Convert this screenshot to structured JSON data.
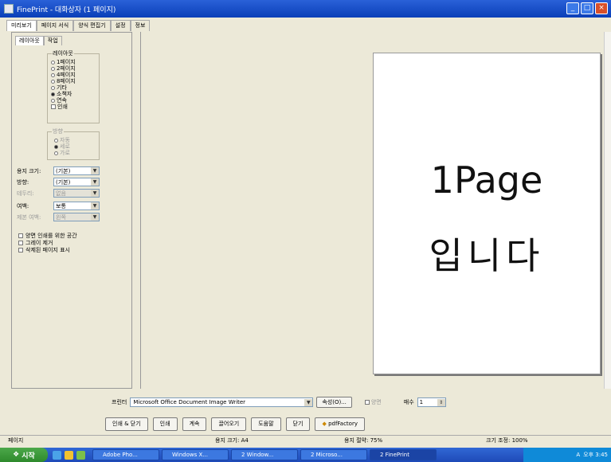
{
  "window": {
    "title": "FinePrint - 대화상자 (1 페이지)"
  },
  "tabs": [
    "미리보기",
    "페이지 서식",
    "양식 편집기",
    "설정",
    "정보"
  ],
  "left_panel": {
    "subtabs": [
      "레이아웃",
      "작업"
    ],
    "layout_group": {
      "label": "레이아웃",
      "options": [
        "1페이지",
        "2페이지",
        "4페이지",
        "8페이지",
        "기타",
        "소책자",
        "연속"
      ],
      "checked": 5,
      "extra_check": "인쇄"
    },
    "orientation_group": {
      "label": "방향",
      "options": [
        "자동",
        "세로",
        "가로"
      ]
    },
    "fields": [
      {
        "label": "용지 크기:",
        "value": "(기본)",
        "disabled": false
      },
      {
        "label": "방향:",
        "value": "(기본)",
        "disabled": false
      },
      {
        "label": "테두리:",
        "value": "없음",
        "disabled": true
      },
      {
        "label": "여백:",
        "value": "보통",
        "disabled": false
      },
      {
        "label": "제본 여백:",
        "value": "왼쪽",
        "disabled": true
      }
    ],
    "checks": [
      "양면 인쇄를 위한 공간",
      "그레이 제거",
      "삭제된 페이지 표시"
    ]
  },
  "preview": {
    "line1": "1Page",
    "line2": "입니다"
  },
  "printer": {
    "label": "프린터",
    "value": "Microsoft Office Document Image Writer",
    "props_button": "속성(O)...",
    "duplex": "양면",
    "copies_label": "매수",
    "copies": "1"
  },
  "buttons": [
    "인쇄 & 닫기",
    "인쇄",
    "계속",
    "끌어오기",
    "도움말",
    "닫기",
    "pdfFactory"
  ],
  "status": {
    "left": "페이지",
    "paper": "용지 크기: A4",
    "sheets": "용지 절약: 75%",
    "zoom": "크기 조정: 100%"
  },
  "taskbar": {
    "start": "시작",
    "tasks": [
      "Adobe Pho...",
      "Windows X...",
      "2 Window...",
      "2 Microso...",
      "2 FinePrint"
    ],
    "clock": "오후 3:45"
  },
  "colors": {
    "title_bar": "#0a3fb8",
    "taskbar": "#1e4ab8",
    "start": "#2e8a2c",
    "tray": "#0f8ad8"
  }
}
